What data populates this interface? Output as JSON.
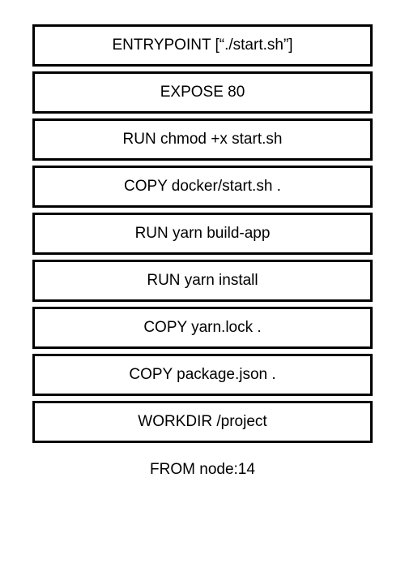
{
  "layers": [
    {
      "text": "ENTRYPOINT [“./start.sh”]"
    },
    {
      "text": "EXPOSE 80"
    },
    {
      "text": "RUN chmod +x start.sh"
    },
    {
      "text": "COPY docker/start.sh ."
    },
    {
      "text": "RUN yarn build-app"
    },
    {
      "text": "RUN yarn install"
    },
    {
      "text": "COPY yarn.lock ."
    },
    {
      "text": "COPY package.json ."
    },
    {
      "text": "WORKDIR /project"
    }
  ],
  "base": "FROM node:14"
}
